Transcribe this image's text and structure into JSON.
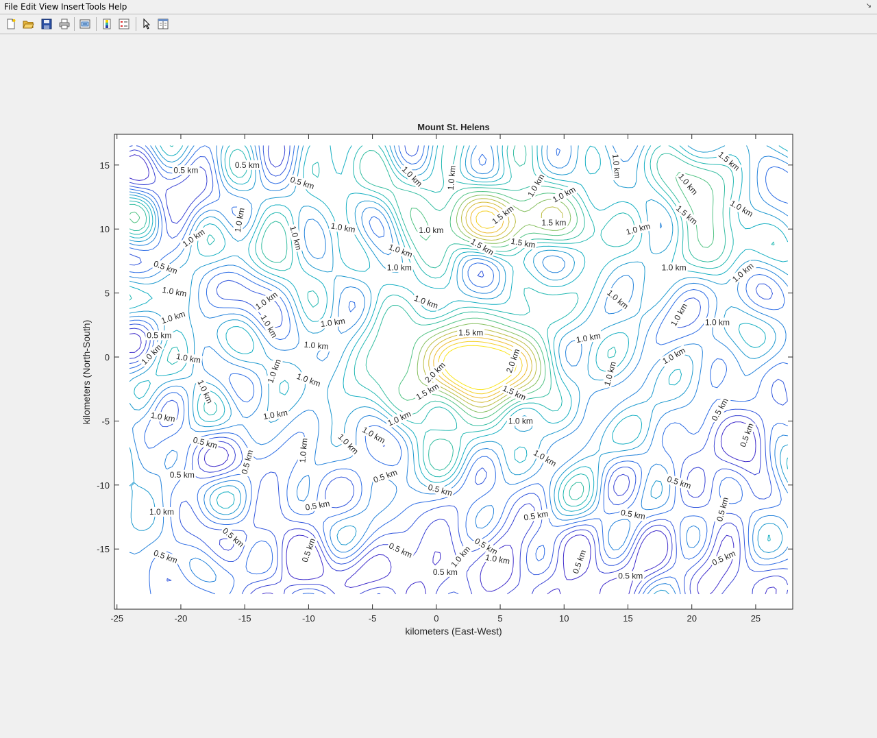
{
  "menu": {
    "items": [
      "File",
      "Edit",
      "View",
      "Insert",
      "Tools",
      "Help"
    ],
    "dock_icon": "dock-arrow-icon"
  },
  "toolbar": {
    "buttons": [
      "new-figure-icon",
      "open-file-icon",
      "save-icon",
      "print-icon",
      "link-plot-icon",
      "insert-colorbar-icon",
      "insert-legend-icon",
      "edit-plot-cursor-icon",
      "property-inspector-icon"
    ]
  },
  "chart_data": {
    "type": "contour",
    "title": "Mount St. Helens",
    "xlabel": "kilometers (East-West)",
    "ylabel": "kilometers (North-South)",
    "xlim": [
      -25.2,
      27.9
    ],
    "ylim": [
      -19.7,
      17.4
    ],
    "xticks": [
      -25,
      -20,
      -15,
      -10,
      -5,
      0,
      5,
      10,
      15,
      20,
      25
    ],
    "yticks": [
      -15,
      -10,
      -5,
      0,
      5,
      10,
      15
    ],
    "xtick_labels": [
      "-25",
      "-20",
      "-15",
      "-10",
      "-5",
      "0",
      "5",
      "10",
      "15",
      "20",
      "25"
    ],
    "ytick_labels": [
      "-15",
      "-10",
      "-5",
      "0",
      "5",
      "10",
      "15"
    ],
    "levels_km": [
      0.5,
      1.0,
      1.5,
      2.0
    ],
    "colormap": "parula",
    "level_colors": [
      "#3f2ccb",
      "#2c6fe6",
      "#14b3c0",
      "#49c48a",
      "#b8bd44",
      "#eeba30",
      "#f9e51f"
    ],
    "labels": [
      {
        "text": "0.5 km",
        "x": -19.6,
        "y": 14.6,
        "angle": 0
      },
      {
        "text": "0.5 km",
        "x": -14.8,
        "y": 15.0,
        "angle": 0
      },
      {
        "text": "0.5 km",
        "x": -10.5,
        "y": 13.6,
        "angle": -18
      },
      {
        "text": "1.0 km",
        "x": -1.9,
        "y": 14.1,
        "angle": -45
      },
      {
        "text": "1.0 km",
        "x": 1.2,
        "y": 14.0,
        "angle": 85
      },
      {
        "text": "1.0 km",
        "x": 7.8,
        "y": 13.4,
        "angle": 60
      },
      {
        "text": "1.0 km",
        "x": 10.0,
        "y": 12.7,
        "angle": 28
      },
      {
        "text": "1.0 km",
        "x": 14.1,
        "y": 14.9,
        "angle": -85
      },
      {
        "text": "1.0 km",
        "x": 19.7,
        "y": 13.5,
        "angle": -50
      },
      {
        "text": "1.5 km",
        "x": 22.9,
        "y": 15.3,
        "angle": -40
      },
      {
        "text": "1.0 km",
        "x": -15.4,
        "y": 10.7,
        "angle": 80
      },
      {
        "text": "1.0 km",
        "x": -19.0,
        "y": 9.3,
        "angle": 35
      },
      {
        "text": "1.0 km",
        "x": -11.0,
        "y": 9.3,
        "angle": -75
      },
      {
        "text": "1.0 km",
        "x": -7.3,
        "y": 10.1,
        "angle": -10
      },
      {
        "text": "1.0 km",
        "x": -0.4,
        "y": 9.9,
        "angle": 0
      },
      {
        "text": "1.5 km",
        "x": 5.2,
        "y": 11.1,
        "angle": 38
      },
      {
        "text": "1.5 km",
        "x": 9.2,
        "y": 10.5,
        "angle": 0
      },
      {
        "text": "1.0 km",
        "x": 15.8,
        "y": 10.0,
        "angle": 15
      },
      {
        "text": "1.5 km",
        "x": 19.6,
        "y": 11.1,
        "angle": -40
      },
      {
        "text": "1.0 km",
        "x": 23.9,
        "y": 11.6,
        "angle": -30
      },
      {
        "text": "1.0 km",
        "x": -2.8,
        "y": 8.3,
        "angle": -20
      },
      {
        "text": "1.5 km",
        "x": 3.6,
        "y": 8.6,
        "angle": -30
      },
      {
        "text": "1.5 km",
        "x": 6.8,
        "y": 8.9,
        "angle": -10
      },
      {
        "text": "0.5 km",
        "x": -21.2,
        "y": 7.0,
        "angle": -20
      },
      {
        "text": "1.0 km",
        "x": -2.9,
        "y": 7.0,
        "angle": 0
      },
      {
        "text": "1.0 km",
        "x": 18.6,
        "y": 7.0,
        "angle": 0
      },
      {
        "text": "1.0 km",
        "x": 24.0,
        "y": 6.6,
        "angle": 40
      },
      {
        "text": "1.0 km",
        "x": -20.5,
        "y": 5.1,
        "angle": -10
      },
      {
        "text": "1.0 km",
        "x": -13.3,
        "y": 4.4,
        "angle": 35
      },
      {
        "text": "1.0 km",
        "x": -0.8,
        "y": 4.3,
        "angle": -20
      },
      {
        "text": "1.0 km",
        "x": 14.2,
        "y": 4.5,
        "angle": -40
      },
      {
        "text": "1.0 km",
        "x": 19.0,
        "y": 3.3,
        "angle": 60
      },
      {
        "text": "1.0 km",
        "x": -20.6,
        "y": 3.1,
        "angle": 18
      },
      {
        "text": "1.0 km",
        "x": -13.1,
        "y": 2.4,
        "angle": -60
      },
      {
        "text": "1.0 km",
        "x": -8.1,
        "y": 2.7,
        "angle": 8
      },
      {
        "text": "1.0 km",
        "x": 22.0,
        "y": 2.7,
        "angle": 0
      },
      {
        "text": "1.5 km",
        "x": 2.7,
        "y": 1.9,
        "angle": 0
      },
      {
        "text": "0.5 km",
        "x": -21.7,
        "y": 1.7,
        "angle": 0
      },
      {
        "text": "1.0 km",
        "x": 11.9,
        "y": 1.5,
        "angle": 10
      },
      {
        "text": "1.0 km",
        "x": -9.4,
        "y": 0.9,
        "angle": -5
      },
      {
        "text": "1.0 km",
        "x": -22.3,
        "y": 0.2,
        "angle": 45
      },
      {
        "text": "1.0 km",
        "x": -19.4,
        "y": -0.1,
        "angle": -10
      },
      {
        "text": "2.0 km",
        "x": 6.0,
        "y": -0.3,
        "angle": 70
      },
      {
        "text": "1.0 km",
        "x": 18.6,
        "y": 0.1,
        "angle": 30
      },
      {
        "text": "2.0 km",
        "x": -0.1,
        "y": -1.2,
        "angle": 45
      },
      {
        "text": "1.0 km",
        "x": 13.6,
        "y": -1.3,
        "angle": 75
      },
      {
        "text": "1.0 km",
        "x": -12.7,
        "y": -1.1,
        "angle": 70
      },
      {
        "text": "1.0 km",
        "x": -10.0,
        "y": -1.8,
        "angle": -20
      },
      {
        "text": "1.5 km",
        "x": -0.7,
        "y": -2.7,
        "angle": 30
      },
      {
        "text": "1.5 km",
        "x": 6.1,
        "y": -2.8,
        "angle": -25
      },
      {
        "text": "1.0 km",
        "x": -18.1,
        "y": -2.7,
        "angle": -65
      },
      {
        "text": "0.5 km",
        "x": 22.2,
        "y": -4.1,
        "angle": 60
      },
      {
        "text": "0.5 km",
        "x": 24.3,
        "y": -6.1,
        "angle": 70
      },
      {
        "text": "1.0 km",
        "x": -21.4,
        "y": -4.7,
        "angle": -10
      },
      {
        "text": "1.0 km",
        "x": -12.6,
        "y": -4.5,
        "angle": 10
      },
      {
        "text": "1.0 km",
        "x": -2.9,
        "y": -4.8,
        "angle": 25
      },
      {
        "text": "1.0 km",
        "x": 6.6,
        "y": -5.0,
        "angle": 0
      },
      {
        "text": "1.0 km",
        "x": -10.4,
        "y": -7.3,
        "angle": 85
      },
      {
        "text": "1.0 km",
        "x": -6.9,
        "y": -6.8,
        "angle": -45
      },
      {
        "text": "1.0 km",
        "x": -4.9,
        "y": -6.1,
        "angle": -30
      },
      {
        "text": "0.5 km",
        "x": -18.1,
        "y": -6.7,
        "angle": -15
      },
      {
        "text": "0.5 km",
        "x": -14.8,
        "y": -8.2,
        "angle": 75
      },
      {
        "text": "1.0 km",
        "x": 8.5,
        "y": -7.9,
        "angle": -30
      },
      {
        "text": "0.5 km",
        "x": -19.9,
        "y": -9.2,
        "angle": 0
      },
      {
        "text": "0.5 km",
        "x": -4.0,
        "y": -9.3,
        "angle": 20
      },
      {
        "text": "0.5 km",
        "x": 19.0,
        "y": -9.8,
        "angle": -18
      },
      {
        "text": "0.5 km",
        "x": 0.3,
        "y": -10.4,
        "angle": -15
      },
      {
        "text": "0.5 km",
        "x": 22.4,
        "y": -11.9,
        "angle": 75
      },
      {
        "text": "1.0 km",
        "x": -21.5,
        "y": -12.1,
        "angle": 0
      },
      {
        "text": "0.5 km",
        "x": -9.3,
        "y": -11.6,
        "angle": 10
      },
      {
        "text": "0.5 km",
        "x": 7.8,
        "y": -12.4,
        "angle": 10
      },
      {
        "text": "0.5 km",
        "x": 15.4,
        "y": -12.3,
        "angle": -10
      },
      {
        "text": "0.5 km",
        "x": -15.9,
        "y": -14.1,
        "angle": -40
      },
      {
        "text": "0.5 km",
        "x": -10.0,
        "y": -15.1,
        "angle": 70
      },
      {
        "text": "0.5 km",
        "x": -21.2,
        "y": -15.6,
        "angle": -20
      },
      {
        "text": "0.5 km",
        "x": -2.8,
        "y": -15.1,
        "angle": -25
      },
      {
        "text": "1.0 km",
        "x": 1.9,
        "y": -15.6,
        "angle": 50
      },
      {
        "text": "0.5 km",
        "x": 3.9,
        "y": -14.8,
        "angle": -30
      },
      {
        "text": "1.0 km",
        "x": 4.8,
        "y": -15.8,
        "angle": -10
      },
      {
        "text": "0.5 km",
        "x": 11.2,
        "y": -16.0,
        "angle": 70
      },
      {
        "text": "0.5 km",
        "x": 22.5,
        "y": -15.7,
        "angle": 25
      },
      {
        "text": "0.5 km",
        "x": 0.7,
        "y": -16.8,
        "angle": 0
      },
      {
        "text": "0.5 km",
        "x": 15.2,
        "y": -17.1,
        "angle": 0
      }
    ]
  }
}
